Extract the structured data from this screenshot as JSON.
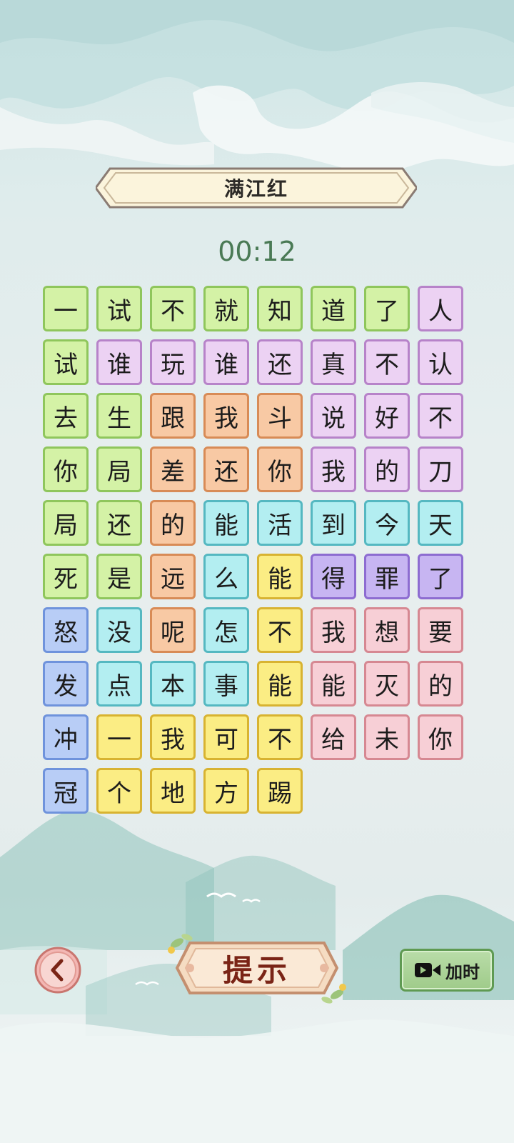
{
  "title": "满江红",
  "timer": "00:12",
  "tile_colors": {
    "green": "#d4f2a6",
    "purple": "#ecd2f3",
    "orange": "#f8c9a4",
    "cyan": "#b3eef1",
    "yellow": "#fbed84",
    "violet": "#c7b5f2",
    "blue": "#b8cdf6",
    "pink": "#f7cfd6"
  },
  "grid": [
    [
      {
        "ch": "一",
        "c": "green"
      },
      {
        "ch": "试",
        "c": "green"
      },
      {
        "ch": "不",
        "c": "green"
      },
      {
        "ch": "就",
        "c": "green"
      },
      {
        "ch": "知",
        "c": "green"
      },
      {
        "ch": "道",
        "c": "green"
      },
      {
        "ch": "了",
        "c": "green"
      },
      {
        "ch": "人",
        "c": "purple"
      }
    ],
    [
      {
        "ch": "试",
        "c": "green"
      },
      {
        "ch": "谁",
        "c": "purple"
      },
      {
        "ch": "玩",
        "c": "purple"
      },
      {
        "ch": "谁",
        "c": "purple"
      },
      {
        "ch": "还",
        "c": "purple"
      },
      {
        "ch": "真",
        "c": "purple"
      },
      {
        "ch": "不",
        "c": "purple"
      },
      {
        "ch": "认",
        "c": "purple"
      }
    ],
    [
      {
        "ch": "去",
        "c": "green"
      },
      {
        "ch": "生",
        "c": "green"
      },
      {
        "ch": "跟",
        "c": "orange"
      },
      {
        "ch": "我",
        "c": "orange"
      },
      {
        "ch": "斗",
        "c": "orange"
      },
      {
        "ch": "说",
        "c": "purple"
      },
      {
        "ch": "好",
        "c": "purple"
      },
      {
        "ch": "不",
        "c": "purple"
      }
    ],
    [
      {
        "ch": "你",
        "c": "green"
      },
      {
        "ch": "局",
        "c": "green"
      },
      {
        "ch": "差",
        "c": "orange"
      },
      {
        "ch": "还",
        "c": "orange"
      },
      {
        "ch": "你",
        "c": "orange"
      },
      {
        "ch": "我",
        "c": "purple"
      },
      {
        "ch": "的",
        "c": "purple"
      },
      {
        "ch": "刀",
        "c": "purple"
      }
    ],
    [
      {
        "ch": "局",
        "c": "green"
      },
      {
        "ch": "还",
        "c": "green"
      },
      {
        "ch": "的",
        "c": "orange"
      },
      {
        "ch": "能",
        "c": "cyan"
      },
      {
        "ch": "活",
        "c": "cyan"
      },
      {
        "ch": "到",
        "c": "cyan"
      },
      {
        "ch": "今",
        "c": "cyan"
      },
      {
        "ch": "天",
        "c": "cyan"
      }
    ],
    [
      {
        "ch": "死",
        "c": "green"
      },
      {
        "ch": "是",
        "c": "green"
      },
      {
        "ch": "远",
        "c": "orange"
      },
      {
        "ch": "么",
        "c": "cyan"
      },
      {
        "ch": "能",
        "c": "yellow"
      },
      {
        "ch": "得",
        "c": "violet"
      },
      {
        "ch": "罪",
        "c": "violet"
      },
      {
        "ch": "了",
        "c": "violet"
      }
    ],
    [
      {
        "ch": "怒",
        "c": "blue"
      },
      {
        "ch": "没",
        "c": "cyan"
      },
      {
        "ch": "呢",
        "c": "orange"
      },
      {
        "ch": "怎",
        "c": "cyan"
      },
      {
        "ch": "不",
        "c": "yellow"
      },
      {
        "ch": "我",
        "c": "pink"
      },
      {
        "ch": "想",
        "c": "pink"
      },
      {
        "ch": "要",
        "c": "pink"
      }
    ],
    [
      {
        "ch": "发",
        "c": "blue"
      },
      {
        "ch": "点",
        "c": "cyan"
      },
      {
        "ch": "本",
        "c": "cyan"
      },
      {
        "ch": "事",
        "c": "cyan"
      },
      {
        "ch": "能",
        "c": "yellow"
      },
      {
        "ch": "能",
        "c": "pink"
      },
      {
        "ch": "灭",
        "c": "pink"
      },
      {
        "ch": "的",
        "c": "pink"
      }
    ],
    [
      {
        "ch": "冲",
        "c": "blue"
      },
      {
        "ch": "一",
        "c": "yellow"
      },
      {
        "ch": "我",
        "c": "yellow"
      },
      {
        "ch": "可",
        "c": "yellow"
      },
      {
        "ch": "不",
        "c": "yellow"
      },
      {
        "ch": "给",
        "c": "pink"
      },
      {
        "ch": "未",
        "c": "pink"
      },
      {
        "ch": "你",
        "c": "pink"
      }
    ],
    [
      {
        "ch": "冠",
        "c": "blue"
      },
      {
        "ch": "个",
        "c": "yellow"
      },
      {
        "ch": "地",
        "c": "yellow"
      },
      {
        "ch": "方",
        "c": "yellow"
      },
      {
        "ch": "踢",
        "c": "yellow"
      }
    ]
  ],
  "controls": {
    "back_icon": "back-arrow-icon",
    "hint_label": "提示",
    "add_time_label": "加时",
    "add_time_icon": "video-camera-icon"
  }
}
